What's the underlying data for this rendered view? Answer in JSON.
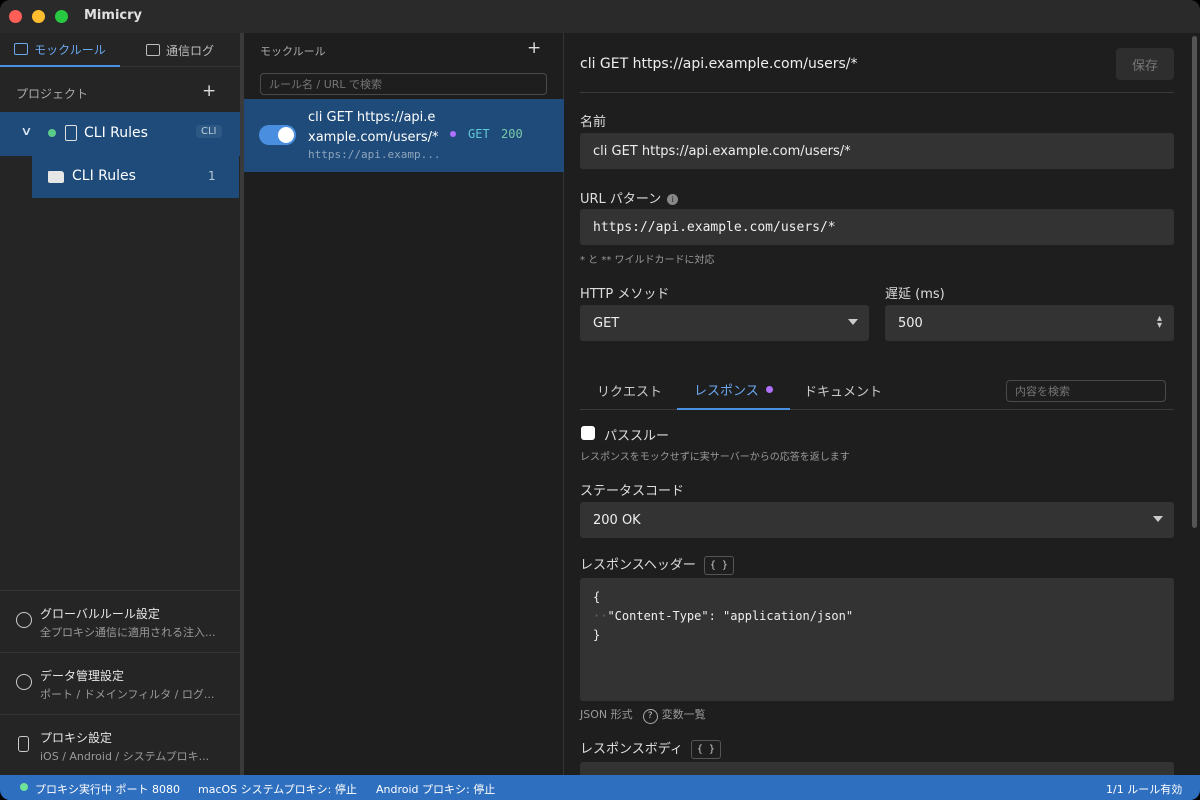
{
  "app": {
    "title": "Mimicry"
  },
  "sidebar": {
    "tabs": [
      {
        "label": "モックルール",
        "icon": "calendar-icon"
      },
      {
        "label": "通信ログ",
        "icon": "list-icon"
      }
    ],
    "project_header": "プロジェクト",
    "add_symbol": "+",
    "project": {
      "name": "CLI Rules",
      "badge": "CLI"
    },
    "folder": {
      "name": "CLI Rules",
      "count": "1"
    },
    "settings": [
      {
        "title": "グローバルルール設定",
        "subtitle": "全プロキシ通信に適用される注入...",
        "icon": "globe-icon"
      },
      {
        "title": "データ管理設定",
        "subtitle": "ポート / ドメインフィルタ / ログ...",
        "icon": "gear-icon"
      },
      {
        "title": "プロキシ設定",
        "subtitle": "iOS / Android / システムプロキ...",
        "icon": "phone-icon"
      }
    ]
  },
  "rules_panel": {
    "header": "モックルール",
    "add_symbol": "+",
    "search_placeholder": "ルール名 / URL で検索",
    "rule": {
      "title": "cli GET https://api.example.com/users/*",
      "url": "https://api.examp...",
      "method": "GET",
      "status": "200",
      "enabled": true
    }
  },
  "editor": {
    "title": "cli GET https://api.example.com/users/*",
    "save_label": "保存",
    "name_label": "名前",
    "name_value": "cli GET https://api.example.com/users/*",
    "url_label": "URL パターン",
    "url_value": "https://api.example.com/users/*",
    "url_hint": "* と ** ワイルドカードに対応",
    "method_label": "HTTP メソッド",
    "method_value": "GET",
    "delay_label": "遅延 (ms)",
    "delay_value": "500",
    "tabs": [
      {
        "label": "リクエスト"
      },
      {
        "label": "レスポンス"
      },
      {
        "label": "ドキュメント"
      }
    ],
    "tab_search_placeholder": "内容を検索",
    "passthrough_label": "パススルー",
    "passthrough_hint": "レスポンスをモックせずに実サーバーからの応答を返します",
    "status_code_label": "ステータスコード",
    "status_code_value": "200 OK",
    "headers_label": "レスポンスヘッダー",
    "braces": "{ }",
    "headers_code": [
      "{",
      "\"Content-Type\": \"application/json\"",
      "}"
    ],
    "json_format_label": "JSON 形式",
    "help_symbol": "?",
    "variables_label": "変数一覧",
    "body_label": "レスポンスボディ"
  },
  "statusbar": {
    "proxy_status": "プロキシ実行中 ポート 8080",
    "macos_proxy": "macOS システムプロキシ: 停止",
    "android_proxy": "Android プロキシ: 停止",
    "rules_active": "1/1 ルール有効"
  },
  "colors": {
    "accent": "#4a90e2",
    "selection": "#1f4b7a",
    "statusbar": "#2f6fbf",
    "purple": "#b070ff"
  }
}
